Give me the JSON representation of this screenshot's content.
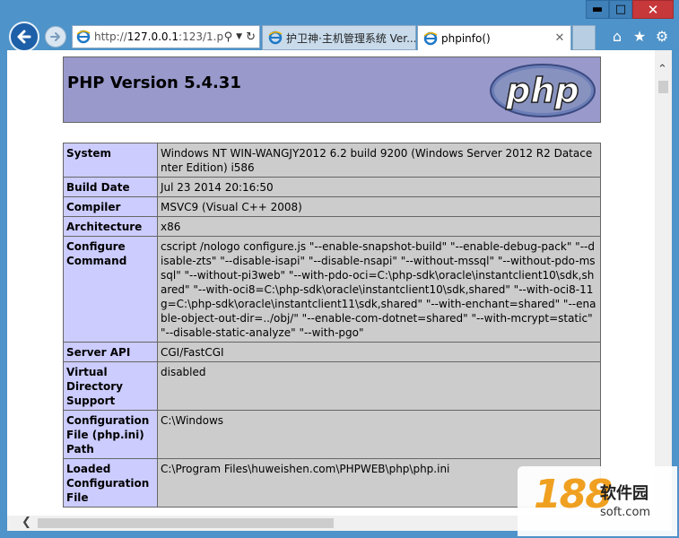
{
  "browser": {
    "address": {
      "prefix": "http://",
      "host": "127.0.0.1",
      "rest": ":123/1.p"
    },
    "tabs": [
      {
        "label": "护卫神·主机管理系统 Ver..."
      },
      {
        "label": "phpinfo()"
      }
    ],
    "caption": {
      "minimize": "▬",
      "maximize": "□",
      "close": "✕"
    }
  },
  "php": {
    "version_title": "PHP Version 5.4.31",
    "logo_text": "php",
    "rows": [
      {
        "key": "System",
        "value": "Windows NT WIN-WANGJY2012 6.2 build 9200 (Windows Server 2012 R2 Datacenter Edition) i586"
      },
      {
        "key": "Build Date",
        "value": "Jul 23 2014 20:16:50"
      },
      {
        "key": "Compiler",
        "value": "MSVC9 (Visual C++ 2008)"
      },
      {
        "key": "Architecture",
        "value": "x86"
      },
      {
        "key": "Configure Command",
        "value": "cscript /nologo configure.js \"--enable-snapshot-build\" \"--enable-debug-pack\" \"--disable-zts\" \"--disable-isapi\" \"--disable-nsapi\" \"--without-mssql\" \"--without-pdo-mssql\" \"--without-pi3web\" \"--with-pdo-oci=C:\\php-sdk\\oracle\\instantclient10\\sdk,shared\" \"--with-oci8=C:\\php-sdk\\oracle\\instantclient10\\sdk,shared\" \"--with-oci8-11g=C:\\php-sdk\\oracle\\instantclient11\\sdk,shared\" \"--with-enchant=shared\" \"--enable-object-out-dir=../obj/\" \"--enable-com-dotnet=shared\" \"--with-mcrypt=static\" \"--disable-static-analyze\" \"--with-pgo\""
      },
      {
        "key": "Server API",
        "value": "CGI/FastCGI"
      },
      {
        "key": "Virtual Directory Support",
        "value": "disabled"
      },
      {
        "key": "Configuration File (php.ini) Path",
        "value": "C:\\Windows"
      },
      {
        "key": "Loaded Configuration File",
        "value": "C:\\Program Files\\huweishen.com\\PHPWEB\\php\\php.ini"
      }
    ]
  },
  "watermark": {
    "number": "188",
    "cn": "软件园",
    "en": "soft.com"
  },
  "colors": {
    "php_header": "#9999cc",
    "key_cell": "#ccccff",
    "value_cell": "#cccccc",
    "frame": "#4e93c9"
  }
}
